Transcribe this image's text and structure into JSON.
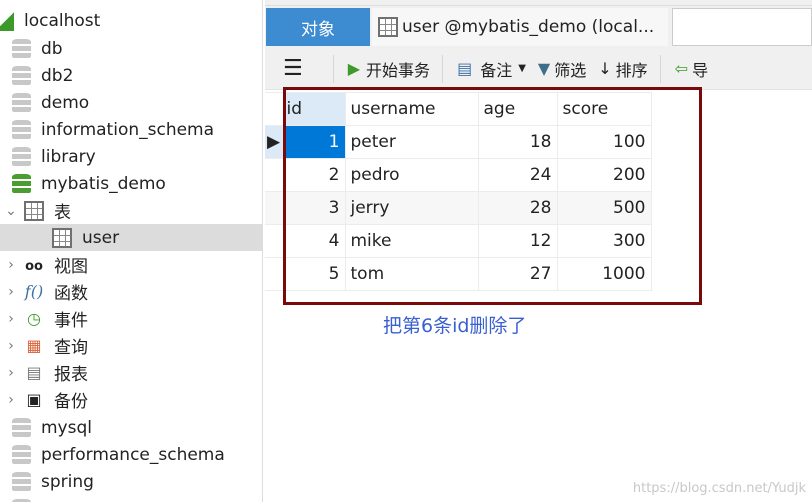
{
  "tree": {
    "connection": "localhost",
    "databases_top": [
      "db",
      "db2",
      "demo",
      "information_schema",
      "library"
    ],
    "active_db": "mybatis_demo",
    "tables_folder": "表",
    "selected_table": "user",
    "folders": [
      {
        "label": "视图",
        "icon": "glasses-icon"
      },
      {
        "label": "函数",
        "icon": "function-icon"
      },
      {
        "label": "事件",
        "icon": "event-clock-icon"
      },
      {
        "label": "查询",
        "icon": "query-icon"
      },
      {
        "label": "报表",
        "icon": "report-icon"
      },
      {
        "label": "备份",
        "icon": "backup-icon"
      }
    ],
    "databases_bottom": [
      "mysql",
      "performance_schema",
      "spring"
    ]
  },
  "tabs": {
    "objects": "对象",
    "table_tab": "user @mybatis_demo (local..."
  },
  "toolbar": {
    "begin_transaction": "开始事务",
    "memo": "备注",
    "filter": "筛选",
    "sort": "排序",
    "import": "导"
  },
  "grid": {
    "columns": [
      "id",
      "username",
      "age",
      "score"
    ],
    "rows": [
      [
        "1",
        "peter",
        "18",
        "100"
      ],
      [
        "2",
        "pedro",
        "24",
        "200"
      ],
      [
        "3",
        "jerry",
        "28",
        "500"
      ],
      [
        "4",
        "mike",
        "12",
        "300"
      ],
      [
        "5",
        "tom",
        "27",
        "1000"
      ]
    ],
    "selected_row": 0
  },
  "annotation": "把第6条id删除了",
  "watermark": "https://blog.csdn.net/Yudjk",
  "colors": {
    "accent": "#3d8bd0",
    "selected_cell": "#0078d7",
    "annotation_box": "#7a0a0a",
    "annotation_text": "#3a5fd0"
  }
}
